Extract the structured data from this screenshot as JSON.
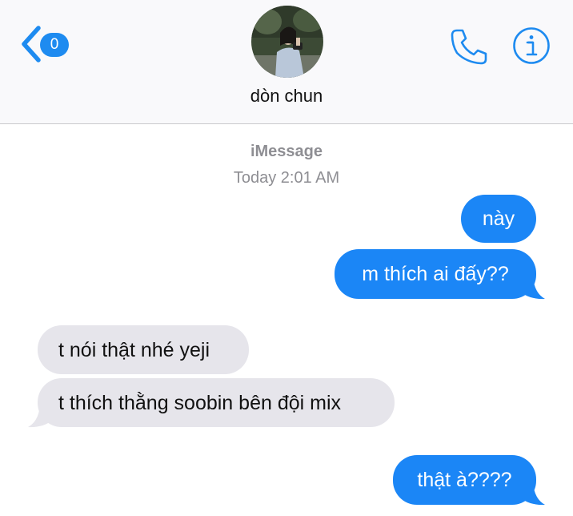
{
  "header": {
    "back_badge": "0",
    "contact_name": "dòn chun"
  },
  "conversation": {
    "service": "iMessage",
    "timestamp": "Today 2:01 AM",
    "messages": [
      {
        "direction": "sent",
        "text": "này"
      },
      {
        "direction": "sent",
        "text": "m thích ai đấy??"
      },
      {
        "direction": "received",
        "text": "t nói thật nhé yeji"
      },
      {
        "direction": "received",
        "text": "t thích thằng soobin bên đội mix"
      },
      {
        "direction": "sent",
        "text": "thật à????"
      }
    ]
  },
  "colors": {
    "accent": "#1e8bf0",
    "sent_bubble": "#1b86f6",
    "received_bubble": "#e6e5eb",
    "secondary_text": "#8e8e93"
  },
  "icons": {
    "back": "chevron-left-icon",
    "call": "phone-icon",
    "info": "info-icon"
  }
}
